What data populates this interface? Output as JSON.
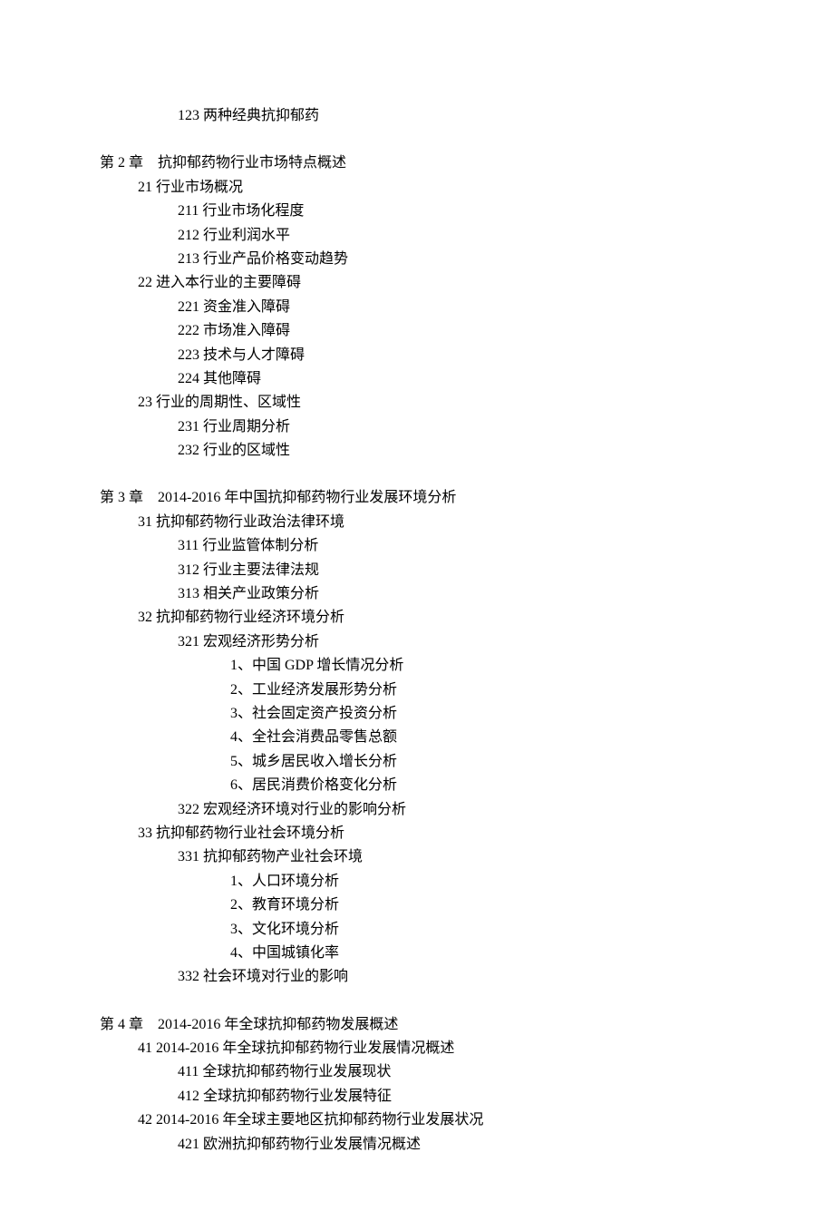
{
  "lines": [
    {
      "level": 1,
      "text": "123 两种经典抗抑郁药",
      "isChapter": false
    },
    {
      "level": 0,
      "text": "第 2 章    抗抑郁药物行业市场特点概述",
      "isChapter": true
    },
    {
      "level": 2,
      "text": "21 行业市场概况",
      "isChapter": false
    },
    {
      "level": 3,
      "text": "211 行业市场化程度",
      "isChapter": false
    },
    {
      "level": 3,
      "text": "212 行业利润水平",
      "isChapter": false
    },
    {
      "level": 3,
      "text": "213 行业产品价格变动趋势",
      "isChapter": false
    },
    {
      "level": 2,
      "text": "22 进入本行业的主要障碍",
      "isChapter": false
    },
    {
      "level": 3,
      "text": "221 资金准入障碍",
      "isChapter": false
    },
    {
      "level": 3,
      "text": "222 市场准入障碍",
      "isChapter": false
    },
    {
      "level": 3,
      "text": "223 技术与人才障碍",
      "isChapter": false
    },
    {
      "level": 3,
      "text": "224 其他障碍",
      "isChapter": false
    },
    {
      "level": 2,
      "text": "23 行业的周期性、区域性",
      "isChapter": false
    },
    {
      "level": 3,
      "text": "231 行业周期分析",
      "isChapter": false
    },
    {
      "level": 3,
      "text": "232 行业的区域性",
      "isChapter": false
    },
    {
      "level": 0,
      "text": "第 3 章    2014-2016 年中国抗抑郁药物行业发展环境分析",
      "isChapter": true
    },
    {
      "level": 2,
      "text": "31 抗抑郁药物行业政治法律环境",
      "isChapter": false
    },
    {
      "level": 3,
      "text": "311 行业监管体制分析",
      "isChapter": false
    },
    {
      "level": 3,
      "text": "312 行业主要法律法规",
      "isChapter": false
    },
    {
      "level": 3,
      "text": "313 相关产业政策分析",
      "isChapter": false
    },
    {
      "level": 2,
      "text": "32 抗抑郁药物行业经济环境分析",
      "isChapter": false
    },
    {
      "level": 3,
      "text": "321 宏观经济形势分析",
      "isChapter": false
    },
    {
      "level": 4,
      "text": "1、中国 GDP 增长情况分析",
      "isChapter": false
    },
    {
      "level": 4,
      "text": "2、工业经济发展形势分析",
      "isChapter": false
    },
    {
      "level": 4,
      "text": "3、社会固定资产投资分析",
      "isChapter": false
    },
    {
      "level": 4,
      "text": "4、全社会消费品零售总额",
      "isChapter": false
    },
    {
      "level": 4,
      "text": "5、城乡居民收入增长分析",
      "isChapter": false
    },
    {
      "level": 4,
      "text": "6、居民消费价格变化分析",
      "isChapter": false
    },
    {
      "level": 3,
      "text": "322 宏观经济环境对行业的影响分析",
      "isChapter": false
    },
    {
      "level": 2,
      "text": "33 抗抑郁药物行业社会环境分析",
      "isChapter": false
    },
    {
      "level": 3,
      "text": "331 抗抑郁药物产业社会环境",
      "isChapter": false
    },
    {
      "level": 4,
      "text": "1、人口环境分析",
      "isChapter": false
    },
    {
      "level": 4,
      "text": "2、教育环境分析",
      "isChapter": false
    },
    {
      "level": 4,
      "text": "3、文化环境分析",
      "isChapter": false
    },
    {
      "level": 4,
      "text": "4、中国城镇化率",
      "isChapter": false
    },
    {
      "level": 3,
      "text": "332 社会环境对行业的影响",
      "isChapter": false
    },
    {
      "level": 0,
      "text": "第 4 章    2014-2016 年全球抗抑郁药物发展概述",
      "isChapter": true
    },
    {
      "level": 2,
      "text": "41 2014-2016 年全球抗抑郁药物行业发展情况概述",
      "isChapter": false
    },
    {
      "level": 3,
      "text": "411 全球抗抑郁药物行业发展现状",
      "isChapter": false
    },
    {
      "level": 3,
      "text": "412 全球抗抑郁药物行业发展特征",
      "isChapter": false
    },
    {
      "level": 2,
      "text": "42 2014-2016 年全球主要地区抗抑郁药物行业发展状况",
      "isChapter": false
    },
    {
      "level": 3,
      "text": "421 欧洲抗抑郁药物行业发展情况概述",
      "isChapter": false
    }
  ]
}
